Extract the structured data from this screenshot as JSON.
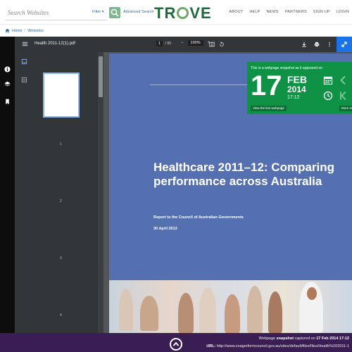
{
  "header": {
    "search_placeholder": "Search Websites",
    "filter_label": "Filter ▾",
    "advanced_search": "Advanced Search",
    "logo_left": "TR",
    "logo_right": "VE",
    "nav": [
      "ABOUT",
      "HELP",
      "NEWS",
      "PARTNERS",
      "SIGN UP",
      "LOGIN"
    ]
  },
  "breadcrumb": {
    "home": "Home",
    "separator": "/",
    "current": "Websites"
  },
  "viewer": {
    "filename": "Health 2011-12(1).pdf",
    "page_current": "1",
    "page_total": "/ 95",
    "zoom": "100%",
    "zoom_minus": "−",
    "zoom_plus": "+",
    "thumbnail_numbers": [
      "1",
      "2",
      "3",
      "4"
    ]
  },
  "document": {
    "title": "Healthcare 2011–12: Comparing performance across Australia",
    "subtitle": "Report to the Council of Australian Governments",
    "date": "30 April 2013"
  },
  "snapshot": {
    "caption": "This is a webpage snapshot as it appeared on",
    "day": "17",
    "month": "FEB",
    "year": "2014",
    "time": "17:12",
    "view_live": "View the live webpage",
    "more": "More sn"
  },
  "footer": {
    "captured_prefix": "Webpage",
    "captured_strong": "snapshot",
    "captured_mid": "captured on",
    "captured_date": "17 Feb 2014 17:12",
    "url_label": "URL:",
    "url": "http://www.coagreformcouncil.gov.au/sites/default/files/files/Health%202011-1"
  },
  "colors": {
    "brand_green": "#0f9146",
    "page_blue": "#5570b0",
    "footer_purple": "#3a1d52",
    "toolbar": "#323639",
    "active_blue": "#1a73e8"
  }
}
